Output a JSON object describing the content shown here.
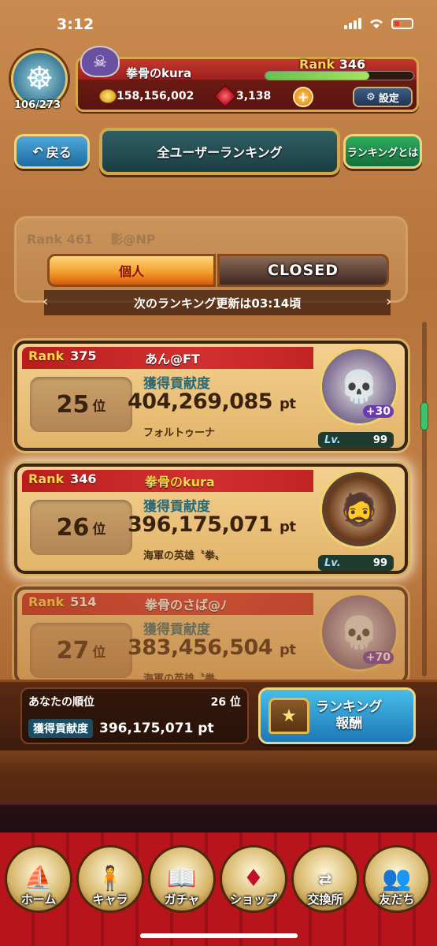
{
  "status_bar": {
    "time": "3:12"
  },
  "header": {
    "player_name": "拳骨のkura",
    "rank_label": "Rank",
    "rank_value": "346",
    "progress": "106/273",
    "coins": "158,156,002",
    "gems": "3,138",
    "plus_label": "+",
    "settings_label": "設定",
    "xp_fill": 0.7
  },
  "nav": {
    "back_label": "戻る",
    "title": "全ユーザーランキング",
    "about_label": "ランキングとは"
  },
  "tabs": {
    "individual": "個人",
    "closed": "CLOSED",
    "update_notice": "次のランキング更新は03:14頃",
    "ghost_rank": "Rank 461",
    "ghost_name": "影@NP"
  },
  "rankings": [
    {
      "rank_label": "Rank",
      "rank": "375",
      "name": "あん@FT",
      "place": "25",
      "place_unit": "位",
      "contrib_label": "獲得貢献度",
      "points": "404,269,085",
      "unit": "pt",
      "character": "フォルトゥーナ",
      "level_label": "Lv.",
      "level": "99",
      "plus": "+30"
    },
    {
      "rank_label": "Rank",
      "rank": "346",
      "name": "拳骨のkura",
      "place": "26",
      "place_unit": "位",
      "contrib_label": "獲得貢献度",
      "points": "396,175,071",
      "unit": "pt",
      "character": "海軍の英雄〝拳〟",
      "level_label": "Lv.",
      "level": "99"
    },
    {
      "rank_label": "Rank",
      "rank": "514",
      "name": "拳骨のさば@ﾉ",
      "place": "27",
      "place_unit": "位",
      "contrib_label": "獲得貢献度",
      "points": "383,456,504",
      "unit": "pt",
      "character": "海軍の英雄〝拳〟",
      "plus": "+70"
    }
  ],
  "summary": {
    "your_rank_label": "あなたの順位",
    "your_rank": "26 位",
    "contrib_label": "獲得貢献度",
    "contrib_value": "396,175,071 pt",
    "reward_line1": "ランキング",
    "reward_line2": "報酬"
  },
  "bottom_nav": [
    {
      "label": "ホーム",
      "icon": "ship-icon"
    },
    {
      "label": "キャラ",
      "icon": "character-icon"
    },
    {
      "label": "ガチャ",
      "icon": "book-icon"
    },
    {
      "label": "ショップ",
      "icon": "gem-icon"
    },
    {
      "label": "交換所",
      "icon": "trade-icon"
    },
    {
      "label": "友だち",
      "icon": "friends-icon"
    }
  ]
}
